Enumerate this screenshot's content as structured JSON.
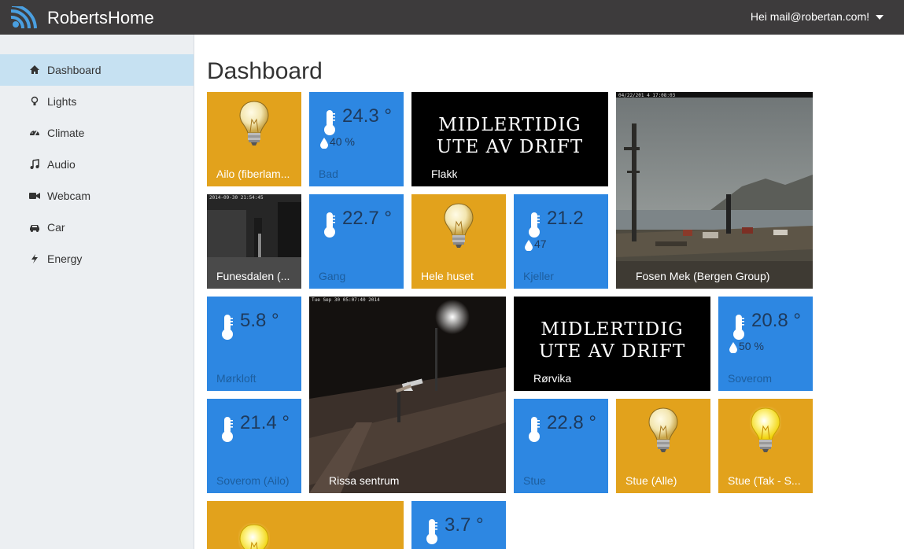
{
  "app": {
    "title": "RobertsHome"
  },
  "user_menu": {
    "greeting": "Hei mail@robertan.com!"
  },
  "sidebar": {
    "items": [
      {
        "label": "Dashboard",
        "icon": "home-icon",
        "active": true
      },
      {
        "label": "Lights",
        "icon": "lightbulb-icon",
        "active": false
      },
      {
        "label": "Climate",
        "icon": "dashboard-gauge-icon",
        "active": false
      },
      {
        "label": "Audio",
        "icon": "music-icon",
        "active": false
      },
      {
        "label": "Webcam",
        "icon": "video-camera-icon",
        "active": false
      },
      {
        "label": "Car",
        "icon": "car-icon",
        "active": false
      },
      {
        "label": "Energy",
        "icon": "bolt-icon",
        "active": false
      }
    ]
  },
  "main": {
    "title": "Dashboard",
    "tiles": {
      "ailo": {
        "label": "Ailo (fiberlam...",
        "kind": "light-off"
      },
      "bad": {
        "label": "Bad",
        "temperature": "24.3 °",
        "humidity": "40 %"
      },
      "flakk": {
        "label": "Flakk",
        "line1": "MIDLERTIDIG",
        "line2": "UTE AV DRIFT"
      },
      "fosen": {
        "label": "Fosen Mek (Bergen Group)",
        "timestamp": "04/22/201 4 17:08:03"
      },
      "funesdalen": {
        "label": "Funesdalen (...",
        "timestamp": "2014-09-30 21:54:45"
      },
      "gang": {
        "label": "Gang",
        "temperature": "22.7 °"
      },
      "hele_huset": {
        "label": "Hele huset",
        "kind": "light-off"
      },
      "kjeller": {
        "label": "Kjeller",
        "temperature": "21.2",
        "humidity": "47"
      },
      "morkloft": {
        "label": "Mørkloft",
        "temperature": "5.8 °"
      },
      "rissa": {
        "label": "Rissa sentrum",
        "timestamp": "Tue Sep 30 05:07:40 2014"
      },
      "rorvika": {
        "label": "Rørvika",
        "line1": "MIDLERTIDIG",
        "line2": "UTE AV DRIFT"
      },
      "soverom": {
        "label": "Soverom",
        "temperature": "20.8 °",
        "humidity": "50 %"
      },
      "soverom_ailo": {
        "label": "Soverom (Ailo)",
        "temperature": "21.4 °"
      },
      "stue": {
        "label": "Stue",
        "temperature": "22.8 °"
      },
      "stue_alle": {
        "label": "Stue (Alle)",
        "kind": "light-off"
      },
      "stue_tak": {
        "label": "Stue (Tak - S...",
        "kind": "light-on"
      },
      "bottom_light": {
        "label": "",
        "kind": "light-on"
      },
      "bottom_temp": {
        "label": "",
        "temperature": "3.7 °"
      }
    }
  },
  "colors": {
    "topbar": "#3d3b3c",
    "brand_accent": "#4a9fe0",
    "light_tile": "#e2a21c",
    "sensor_tile": "#2d87e2",
    "webcam_tile": "#000000",
    "active_nav": "#c6e1f2"
  }
}
